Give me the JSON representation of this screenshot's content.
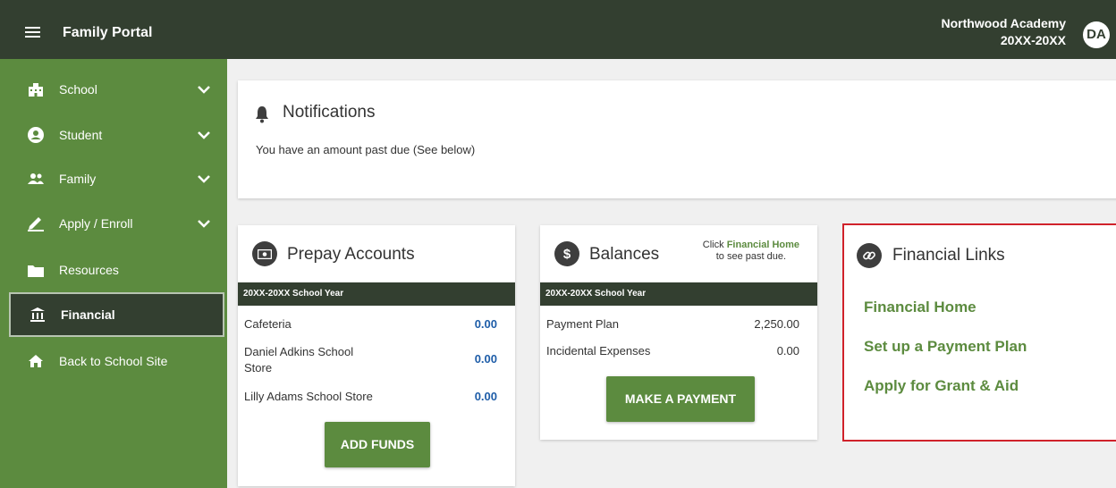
{
  "header": {
    "app_title": "Family Portal",
    "school_name": "Northwood Academy",
    "school_year": "20XX-20XX",
    "avatar_initials": "DA"
  },
  "sidebar": {
    "items": [
      {
        "label": "School",
        "icon": "building-icon",
        "expandable": true
      },
      {
        "label": "Student",
        "icon": "user-circle-icon",
        "expandable": true
      },
      {
        "label": "Family",
        "icon": "users-icon",
        "expandable": true
      },
      {
        "label": "Apply / Enroll",
        "icon": "pen-icon",
        "expandable": true
      },
      {
        "label": "Resources",
        "icon": "folder-icon",
        "expandable": false
      },
      {
        "label": "Financial",
        "icon": "bank-icon",
        "expandable": false,
        "active": true
      },
      {
        "label": "Back to School Site",
        "icon": "home-icon",
        "expandable": false
      }
    ]
  },
  "notifications": {
    "title": "Notifications",
    "message": "You have an amount past due (See below)"
  },
  "prepay": {
    "title": "Prepay Accounts",
    "year_label": "20XX-20XX School Year",
    "rows": [
      {
        "name": "Cafeteria",
        "value": "0.00"
      },
      {
        "name": "Daniel Adkins School Store",
        "value": "0.00"
      },
      {
        "name": "Lilly Adams School Store",
        "value": "0.00"
      }
    ],
    "button_label": "ADD FUNDS"
  },
  "balances": {
    "title": "Balances",
    "hint_prefix": "Click",
    "hint_link": "Financial Home",
    "hint_suffix": "to see past due.",
    "year_label": "20XX-20XX School Year",
    "rows": [
      {
        "name": "Payment Plan",
        "value": "2,250.00"
      },
      {
        "name": "Incidental Expenses",
        "value": "0.00"
      }
    ],
    "button_label": "MAKE A PAYMENT"
  },
  "financial_links": {
    "title": "Financial Links",
    "links": [
      "Financial Home",
      "Set up a Payment Plan",
      "Apply for Grant & Aid"
    ]
  },
  "colors": {
    "header_bg": "#333f30",
    "sidebar_bg": "#5c8b3f",
    "accent_green": "#5c8b3f",
    "value_blue": "#1e5da8",
    "highlight_red": "#d0222b"
  }
}
